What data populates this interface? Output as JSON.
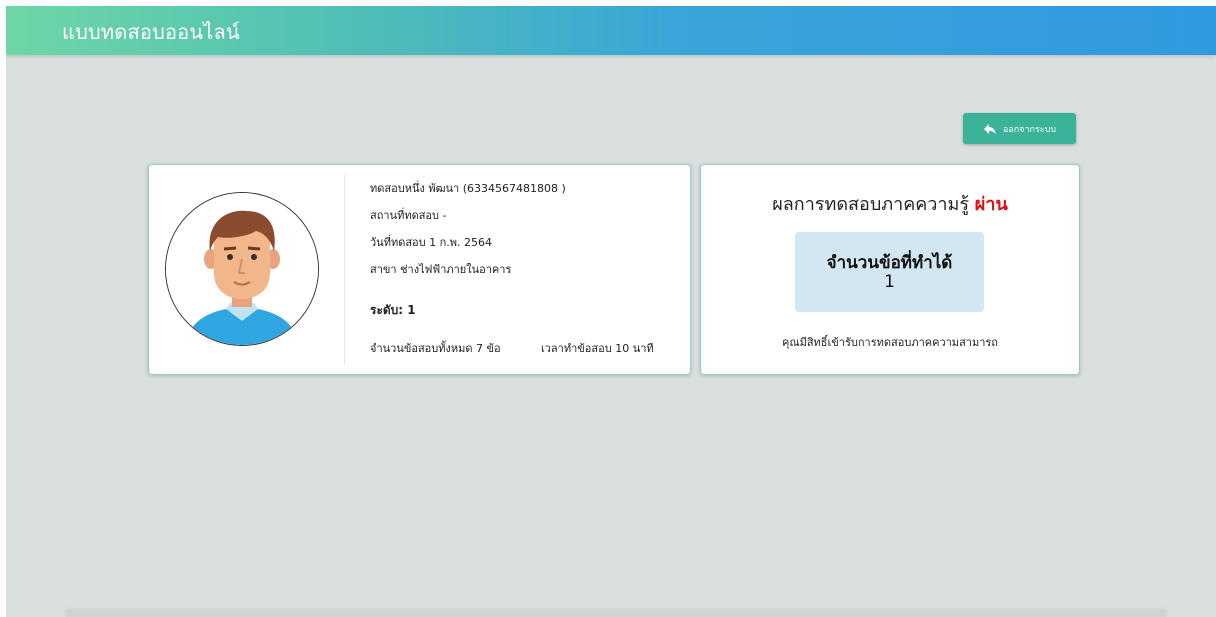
{
  "app": {
    "title": "แบบทดสอบออนไลน์"
  },
  "header": {
    "logout_label": "ออกจากระบบ",
    "logout_icon": "reply-arrow-icon"
  },
  "profile": {
    "name_line": "ทดสอบหนึ่ง พัฒนา (6334567481808 )",
    "location": "สถานที่ทดสอบ -",
    "date": "วันที่ทดสอบ 1 ก.พ. 2564",
    "branch": "สาขา ช่างไฟฟ้าภายในอาคาร",
    "level": "ระดับ: 1",
    "total_questions": "จำนวนข้อสอบทั้งหมด 7 ข้อ",
    "duration": "เวลาทำข้อสอบ 10 นาที",
    "avatar_icon": "person-avatar-icon"
  },
  "result": {
    "title_prefix": "ผลการทดสอบภาคความรู้",
    "status": "ผ่าน",
    "status_color": "#e01010",
    "score_label": "จำนวนข้อที่ทำได้",
    "score_value": "1",
    "note": "คุณมีสิทธิ์เข้ารับการทดสอบภาคความสามารถ"
  },
  "colors": {
    "header_gradient_start": "#6fd6a6",
    "header_gradient_end": "#2e9ae0",
    "button_bg": "#3ab39a",
    "page_bg": "#d9dfde",
    "score_box_bg": "#d3e7f3"
  }
}
